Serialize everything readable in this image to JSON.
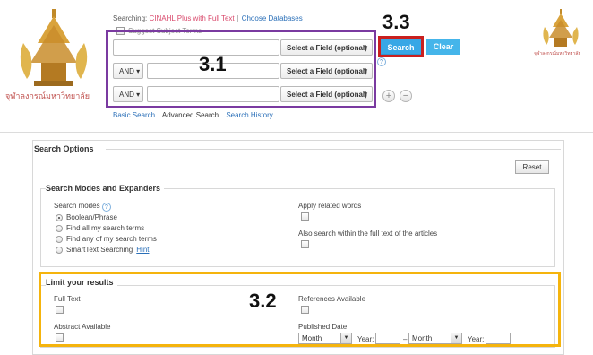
{
  "logo_left": {
    "caption": "จุฬาลงกรณ์มหาวิทยาลัย"
  },
  "logo_right": {
    "caption": "จุฬาลงกรณ์มหาวิทยาลัย"
  },
  "header": {
    "searching_label": "Searching:",
    "database": "CINAHL Plus with Full Text",
    "choose_db": "Choose Databases",
    "suggest_terms": "Suggest Subject Terms"
  },
  "search_rows": [
    {
      "bool": "",
      "field": "Select a Field (optional)"
    },
    {
      "bool": "AND",
      "field": "Select a Field (optional)"
    },
    {
      "bool": "AND",
      "field": "Select a Field (optional)"
    }
  ],
  "buttons": {
    "search": "Search",
    "clear": "Clear",
    "reset": "Reset",
    "help": "?",
    "add": "+",
    "remove": "−"
  },
  "nav": {
    "basic": "Basic Search",
    "advanced": "Advanced Search",
    "history": "Search History"
  },
  "annotations": {
    "a31": "3.1",
    "a32": "3.2",
    "a33": "3.3"
  },
  "options": {
    "title": "Search Options",
    "modes_section_title": "Search Modes and Expanders",
    "modes_label": "Search modes",
    "modes": [
      {
        "label": "Boolean/Phrase",
        "selected": true
      },
      {
        "label": "Find all my search terms",
        "selected": false
      },
      {
        "label": "Find any of my search terms",
        "selected": false
      },
      {
        "label": "SmartText Searching",
        "selected": false
      }
    ],
    "hint": "Hint",
    "apply_related": "Apply related words",
    "full_text_search": "Also search within the full text of the articles"
  },
  "limits": {
    "title": "Limit your results",
    "full_text": "Full Text",
    "references": "References Available",
    "abstract": "Abstract Available",
    "published": "Published Date",
    "month": "Month",
    "year": "Year:",
    "dash": "–"
  },
  "colors": {
    "purple": "#7a3aa0",
    "red": "#c9201f",
    "yellow": "#f5b40d",
    "search_blue": "#37a7e6"
  }
}
